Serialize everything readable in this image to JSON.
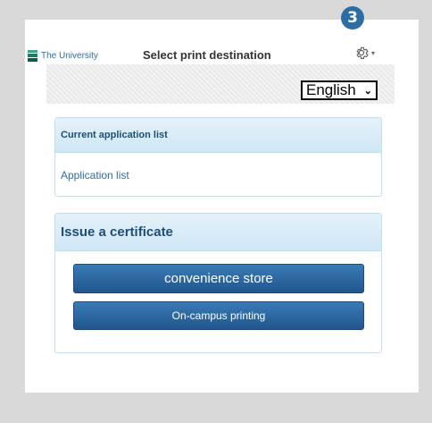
{
  "step": {
    "number": "3",
    "color": "#2e6da4"
  },
  "header": {
    "logo_text": "The University",
    "title": "Select print destination",
    "settings_icon": "gear-icon"
  },
  "language": {
    "selected": "English"
  },
  "current_panel": {
    "heading": "Current application list",
    "link": "Application list"
  },
  "issue_panel": {
    "heading": "Issue a certificate",
    "buttons": [
      "convenience store",
      "On-campus printing"
    ]
  },
  "colors": {
    "accent": "#2e6da4",
    "panel_header": "#cfe7f5",
    "panel_border": "#bfe0f0",
    "button": "#2a649e",
    "background": "#d9d9d9"
  }
}
